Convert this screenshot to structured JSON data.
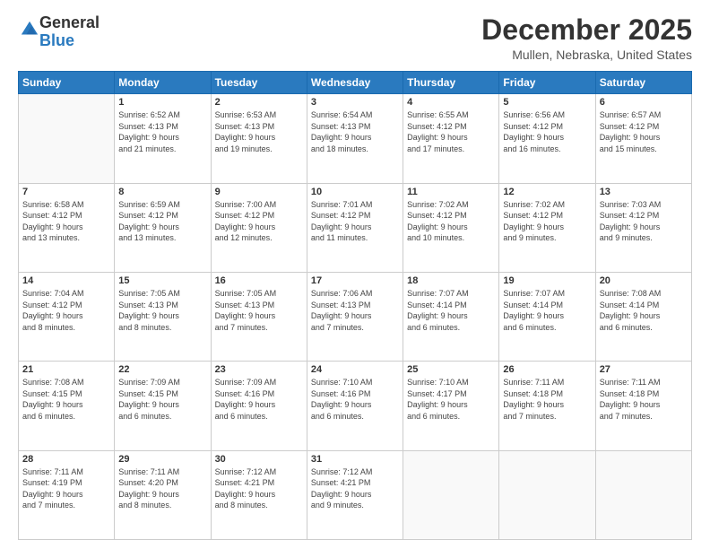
{
  "logo": {
    "general": "General",
    "blue": "Blue"
  },
  "header": {
    "title": "December 2025",
    "subtitle": "Mullen, Nebraska, United States"
  },
  "weekdays": [
    "Sunday",
    "Monday",
    "Tuesday",
    "Wednesday",
    "Thursday",
    "Friday",
    "Saturday"
  ],
  "weeks": [
    [
      {
        "day": "",
        "info": ""
      },
      {
        "day": "1",
        "info": "Sunrise: 6:52 AM\nSunset: 4:13 PM\nDaylight: 9 hours\nand 21 minutes."
      },
      {
        "day": "2",
        "info": "Sunrise: 6:53 AM\nSunset: 4:13 PM\nDaylight: 9 hours\nand 19 minutes."
      },
      {
        "day": "3",
        "info": "Sunrise: 6:54 AM\nSunset: 4:13 PM\nDaylight: 9 hours\nand 18 minutes."
      },
      {
        "day": "4",
        "info": "Sunrise: 6:55 AM\nSunset: 4:12 PM\nDaylight: 9 hours\nand 17 minutes."
      },
      {
        "day": "5",
        "info": "Sunrise: 6:56 AM\nSunset: 4:12 PM\nDaylight: 9 hours\nand 16 minutes."
      },
      {
        "day": "6",
        "info": "Sunrise: 6:57 AM\nSunset: 4:12 PM\nDaylight: 9 hours\nand 15 minutes."
      }
    ],
    [
      {
        "day": "7",
        "info": "Sunrise: 6:58 AM\nSunset: 4:12 PM\nDaylight: 9 hours\nand 13 minutes."
      },
      {
        "day": "8",
        "info": "Sunrise: 6:59 AM\nSunset: 4:12 PM\nDaylight: 9 hours\nand 13 minutes."
      },
      {
        "day": "9",
        "info": "Sunrise: 7:00 AM\nSunset: 4:12 PM\nDaylight: 9 hours\nand 12 minutes."
      },
      {
        "day": "10",
        "info": "Sunrise: 7:01 AM\nSunset: 4:12 PM\nDaylight: 9 hours\nand 11 minutes."
      },
      {
        "day": "11",
        "info": "Sunrise: 7:02 AM\nSunset: 4:12 PM\nDaylight: 9 hours\nand 10 minutes."
      },
      {
        "day": "12",
        "info": "Sunrise: 7:02 AM\nSunset: 4:12 PM\nDaylight: 9 hours\nand 9 minutes."
      },
      {
        "day": "13",
        "info": "Sunrise: 7:03 AM\nSunset: 4:12 PM\nDaylight: 9 hours\nand 9 minutes."
      }
    ],
    [
      {
        "day": "14",
        "info": "Sunrise: 7:04 AM\nSunset: 4:12 PM\nDaylight: 9 hours\nand 8 minutes."
      },
      {
        "day": "15",
        "info": "Sunrise: 7:05 AM\nSunset: 4:13 PM\nDaylight: 9 hours\nand 8 minutes."
      },
      {
        "day": "16",
        "info": "Sunrise: 7:05 AM\nSunset: 4:13 PM\nDaylight: 9 hours\nand 7 minutes."
      },
      {
        "day": "17",
        "info": "Sunrise: 7:06 AM\nSunset: 4:13 PM\nDaylight: 9 hours\nand 7 minutes."
      },
      {
        "day": "18",
        "info": "Sunrise: 7:07 AM\nSunset: 4:14 PM\nDaylight: 9 hours\nand 6 minutes."
      },
      {
        "day": "19",
        "info": "Sunrise: 7:07 AM\nSunset: 4:14 PM\nDaylight: 9 hours\nand 6 minutes."
      },
      {
        "day": "20",
        "info": "Sunrise: 7:08 AM\nSunset: 4:14 PM\nDaylight: 9 hours\nand 6 minutes."
      }
    ],
    [
      {
        "day": "21",
        "info": "Sunrise: 7:08 AM\nSunset: 4:15 PM\nDaylight: 9 hours\nand 6 minutes."
      },
      {
        "day": "22",
        "info": "Sunrise: 7:09 AM\nSunset: 4:15 PM\nDaylight: 9 hours\nand 6 minutes."
      },
      {
        "day": "23",
        "info": "Sunrise: 7:09 AM\nSunset: 4:16 PM\nDaylight: 9 hours\nand 6 minutes."
      },
      {
        "day": "24",
        "info": "Sunrise: 7:10 AM\nSunset: 4:16 PM\nDaylight: 9 hours\nand 6 minutes."
      },
      {
        "day": "25",
        "info": "Sunrise: 7:10 AM\nSunset: 4:17 PM\nDaylight: 9 hours\nand 6 minutes."
      },
      {
        "day": "26",
        "info": "Sunrise: 7:11 AM\nSunset: 4:18 PM\nDaylight: 9 hours\nand 7 minutes."
      },
      {
        "day": "27",
        "info": "Sunrise: 7:11 AM\nSunset: 4:18 PM\nDaylight: 9 hours\nand 7 minutes."
      }
    ],
    [
      {
        "day": "28",
        "info": "Sunrise: 7:11 AM\nSunset: 4:19 PM\nDaylight: 9 hours\nand 7 minutes."
      },
      {
        "day": "29",
        "info": "Sunrise: 7:11 AM\nSunset: 4:20 PM\nDaylight: 9 hours\nand 8 minutes."
      },
      {
        "day": "30",
        "info": "Sunrise: 7:12 AM\nSunset: 4:21 PM\nDaylight: 9 hours\nand 8 minutes."
      },
      {
        "day": "31",
        "info": "Sunrise: 7:12 AM\nSunset: 4:21 PM\nDaylight: 9 hours\nand 9 minutes."
      },
      {
        "day": "",
        "info": ""
      },
      {
        "day": "",
        "info": ""
      },
      {
        "day": "",
        "info": ""
      }
    ]
  ]
}
